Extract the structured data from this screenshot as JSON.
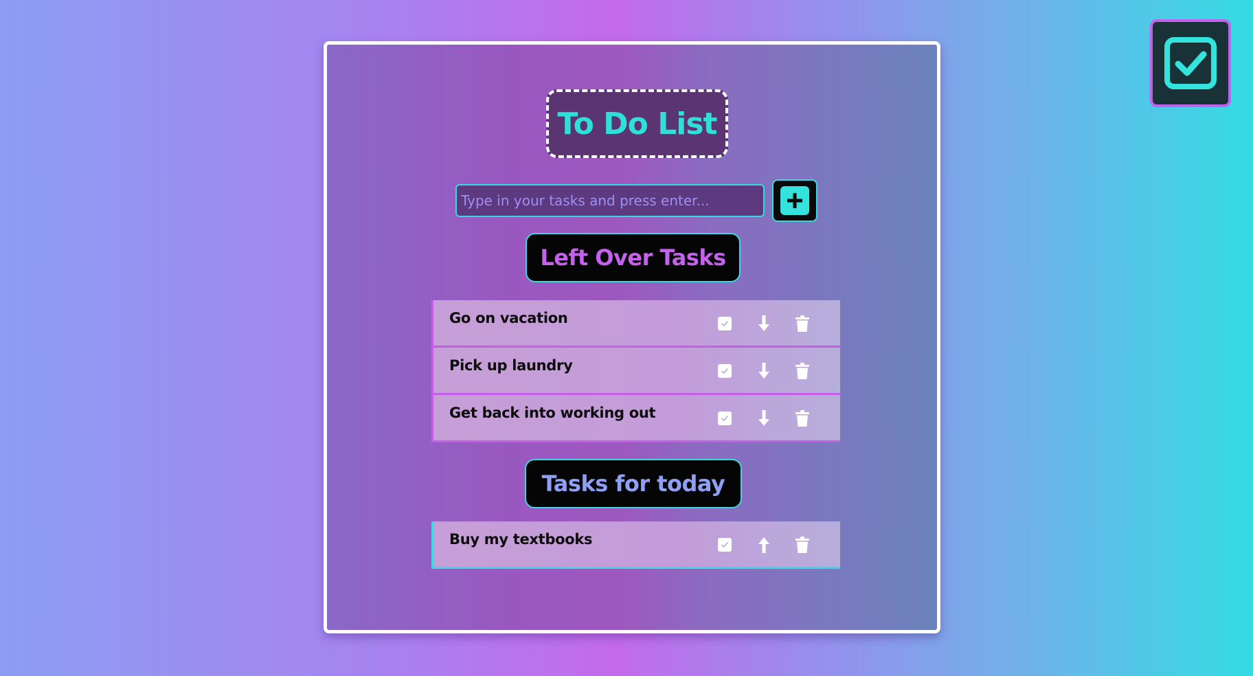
{
  "app": {
    "title": "To Do List"
  },
  "input": {
    "placeholder": "Type in your tasks and press enter..."
  },
  "add_button": {
    "icon": "plus-icon"
  },
  "sections": {
    "left_over": {
      "heading": "Left Over Tasks",
      "tasks": [
        {
          "text": "Go on vacation",
          "move_icon": "arrow-down-icon"
        },
        {
          "text": "Pick up laundry",
          "move_icon": "arrow-down-icon"
        },
        {
          "text": "Get back into working out",
          "move_icon": "arrow-down-icon"
        }
      ]
    },
    "today": {
      "heading": "Tasks for today",
      "tasks": [
        {
          "text": "Buy my textbooks",
          "move_icon": "arrow-up-icon"
        }
      ]
    }
  },
  "colors": {
    "accent_cyan": "#38d9e0",
    "accent_purple": "#c45ee9",
    "title_text": "#2fe0da",
    "left_over_heading": "#c462ec",
    "today_heading": "#8fa0f4"
  },
  "icons": {
    "corner": "checkbox-checked-icon",
    "task_actions": [
      "checkbox-icon",
      "arrow-icon",
      "trash-icon"
    ]
  }
}
